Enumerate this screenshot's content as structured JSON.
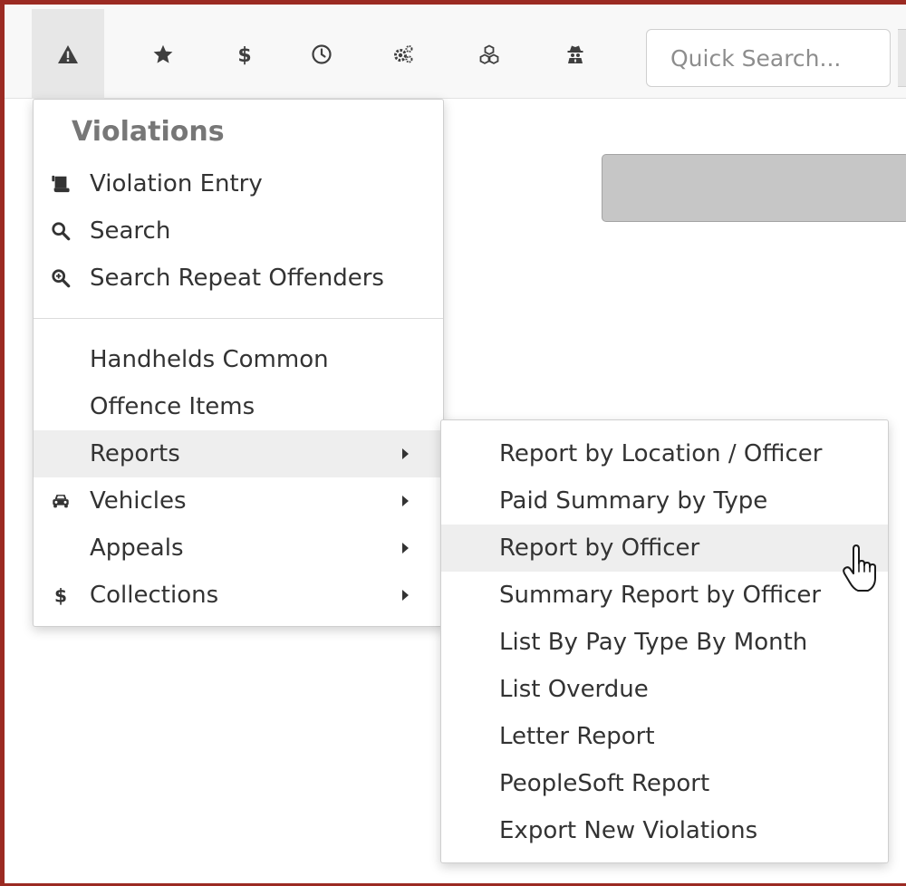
{
  "toolbar": {
    "icons": [
      "warning-icon",
      "star-icon",
      "dollar-icon",
      "clock-icon",
      "cogs-icon",
      "cubes-icon",
      "user-secret-icon"
    ],
    "search_placeholder": "Quick Search..."
  },
  "menu": {
    "header": "Violations",
    "items": [
      {
        "label": "Violation Entry",
        "icon": "scroll-icon"
      },
      {
        "label": "Search",
        "icon": "search-icon"
      },
      {
        "label": "Search Repeat Offenders",
        "icon": "search-plus-icon"
      },
      {
        "label": "Handhelds Common"
      },
      {
        "label": "Offence Items"
      },
      {
        "label": "Reports",
        "submenu": true,
        "highlighted": true
      },
      {
        "label": "Vehicles",
        "icon": "car-icon",
        "submenu": true
      },
      {
        "label": "Appeals",
        "submenu": true
      },
      {
        "label": "Collections",
        "icon": "dollar-icon",
        "submenu": true
      }
    ]
  },
  "submenu": {
    "items": [
      {
        "label": "Report by Location / Officer"
      },
      {
        "label": "Paid Summary by Type"
      },
      {
        "label": "Report by Officer",
        "highlighted": true
      },
      {
        "label": "Summary Report by Officer"
      },
      {
        "label": "List By Pay Type By Month"
      },
      {
        "label": "List Overdue"
      },
      {
        "label": "Letter Report"
      },
      {
        "label": "PeopleSoft Report"
      },
      {
        "label": "Export New Violations"
      }
    ]
  },
  "colors": {
    "frame": "#9b2a22",
    "highlight": "#eeeeee",
    "toolbar_bg": "#f8f8f8"
  }
}
